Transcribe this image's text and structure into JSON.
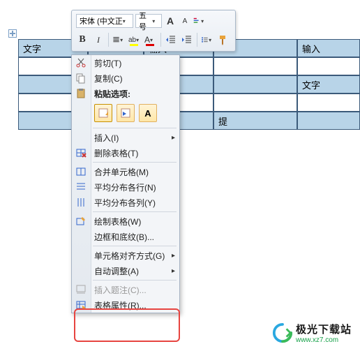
{
  "toolbar": {
    "font_name": "宋体 (中文正",
    "font_size": "五号",
    "grow_font": "A",
    "shrink_font": "A",
    "bold": "B",
    "italic": "I",
    "font_color_letter": "A",
    "highlight_letter": "ab"
  },
  "table": {
    "rows": [
      [
        "文字",
        "",
        "输入",
        "",
        "输入"
      ],
      [
        "",
        "",
        "",
        "",
        ""
      ],
      [
        "",
        "",
        "",
        "",
        "文字"
      ],
      [
        "",
        "",
        "",
        "",
        ""
      ],
      [
        "",
        "",
        "",
        "提",
        ""
      ]
    ]
  },
  "context_menu": {
    "cut": "剪切(T)",
    "copy": "复制(C)",
    "paste_options_label": "粘贴选项:",
    "insert": "插入(I)",
    "delete_table": "删除表格(T)",
    "merge_cells": "合并单元格(M)",
    "distribute_rows": "平均分布各行(N)",
    "distribute_cols": "平均分布各列(Y)",
    "draw_table": "绘制表格(W)",
    "borders_shading": "边框和底纹(B)...",
    "cell_alignment": "单元格对齐方式(G)",
    "autofit": "自动调整(A)",
    "insert_caption": "插入题注(C)...",
    "table_properties": "表格属性(R)..."
  },
  "logo": {
    "name": "极光下载站",
    "url": "www.xz7.com"
  }
}
